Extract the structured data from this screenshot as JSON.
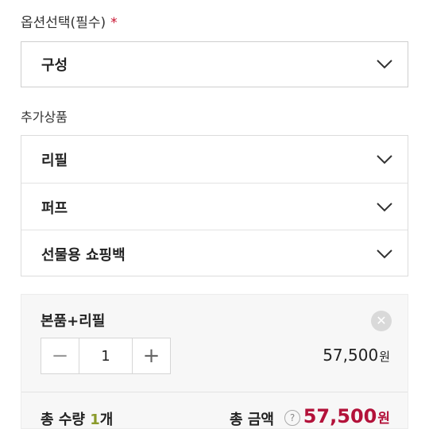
{
  "options": {
    "label": "옵션선택(필수)",
    "required_mark": "*",
    "select": {
      "value": "구성",
      "icon": "chevron-down-icon"
    }
  },
  "addons": {
    "label": "추가상품",
    "items": [
      {
        "label": "리필",
        "icon": "chevron-down-icon"
      },
      {
        "label": "퍼프",
        "icon": "chevron-down-icon"
      },
      {
        "label": "선물용 쇼핑백",
        "icon": "chevron-down-icon"
      }
    ]
  },
  "selected_item": {
    "name": "본품+리필",
    "remove_icon": "close-icon",
    "quantity": "1",
    "minus_label": "−",
    "plus_label": "+",
    "price": "57,500",
    "currency": "원"
  },
  "summary": {
    "total_qty_prefix": "총 수량 ",
    "total_qty_value": "1",
    "total_qty_suffix": "개",
    "total_amount_label": "총 금액",
    "help_icon": "?",
    "total_amount": "57,500",
    "currency": "원"
  },
  "colors": {
    "accent_price": "#b3123a",
    "required_star": "#c8102e",
    "qty_highlight": "#8a9a2a"
  }
}
